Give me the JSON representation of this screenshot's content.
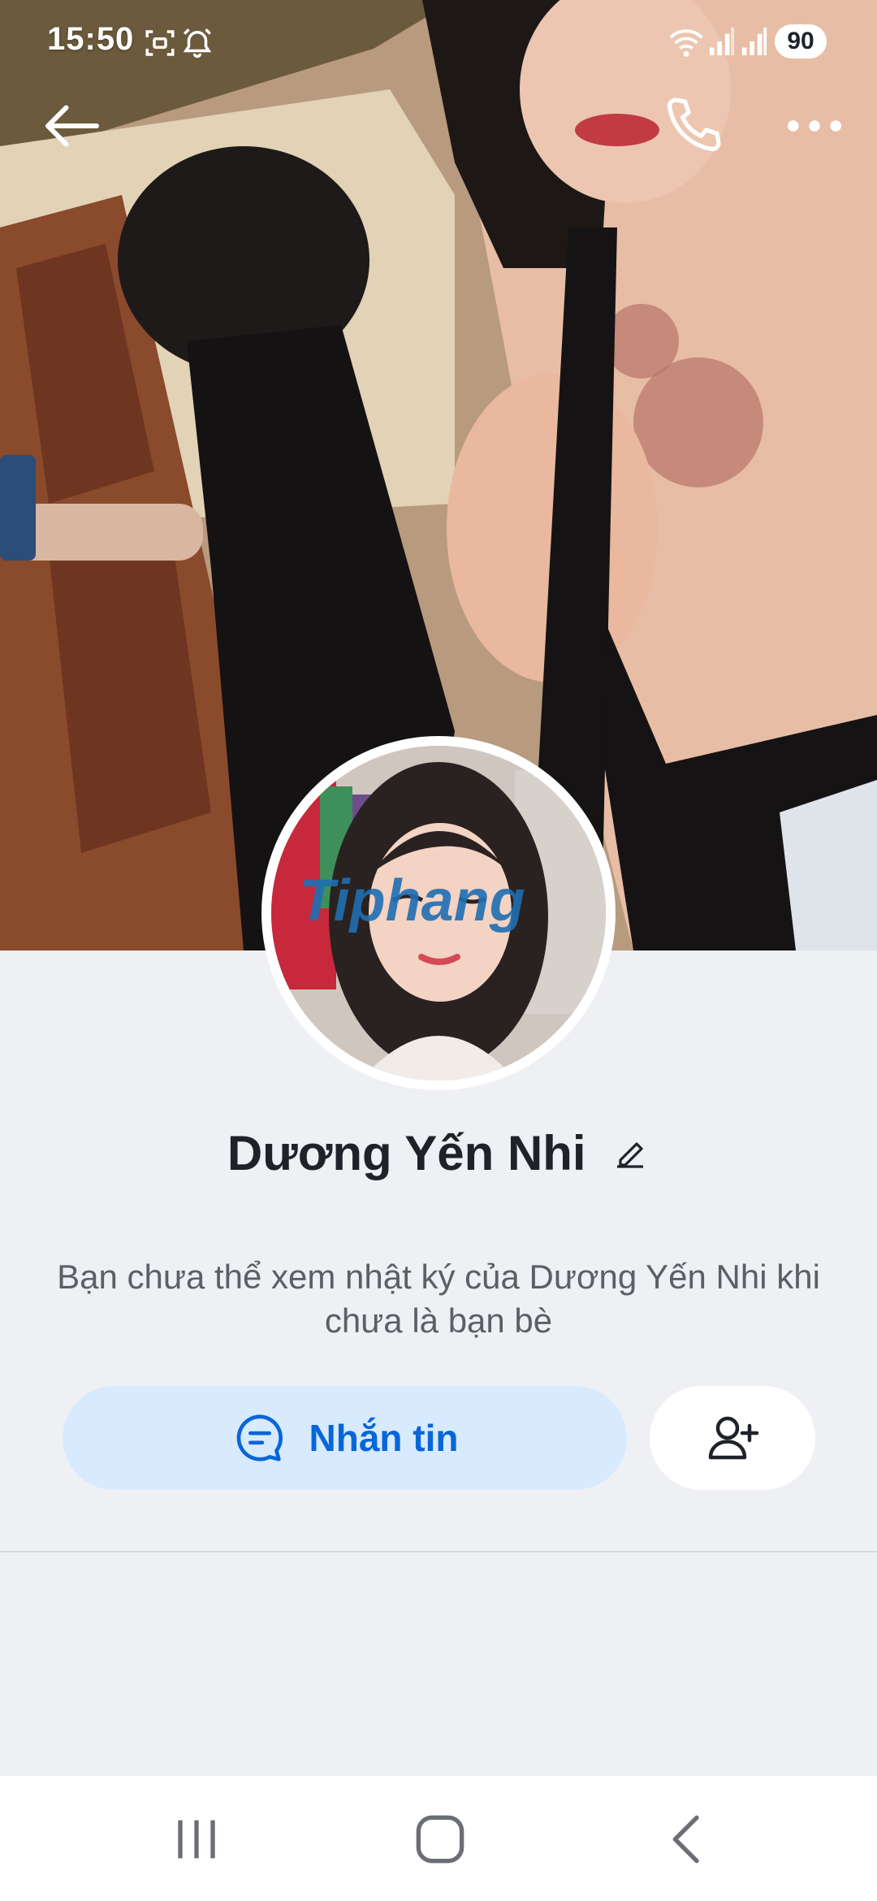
{
  "status_bar": {
    "time": "15:50",
    "battery": "90",
    "icons": [
      "screenshot-icon",
      "alarm-icon",
      "wifi-icon",
      "signal-icon",
      "signal-icon"
    ]
  },
  "header": {
    "back_icon": "arrow-left-icon",
    "call_icon": "phone-icon",
    "more_icon": "more-horizontal-icon"
  },
  "profile": {
    "name": "Dương Yến Nhi",
    "privacy_note": "Bạn chưa thể xem nhật ký của Dương Yến Nhi khi chưa là bạn bè"
  },
  "actions": {
    "message_label": "Nhắn tin",
    "message_icon": "chat-bubble-icon",
    "add_friend_icon": "user-plus-icon"
  },
  "watermark": "Tiphang",
  "nav": [
    "recent-apps-icon",
    "home-icon",
    "back-icon"
  ],
  "colors": {
    "accent": "#0866d9",
    "message_button_bg": "#d8eafd",
    "page_bg": "#eff0f4"
  }
}
